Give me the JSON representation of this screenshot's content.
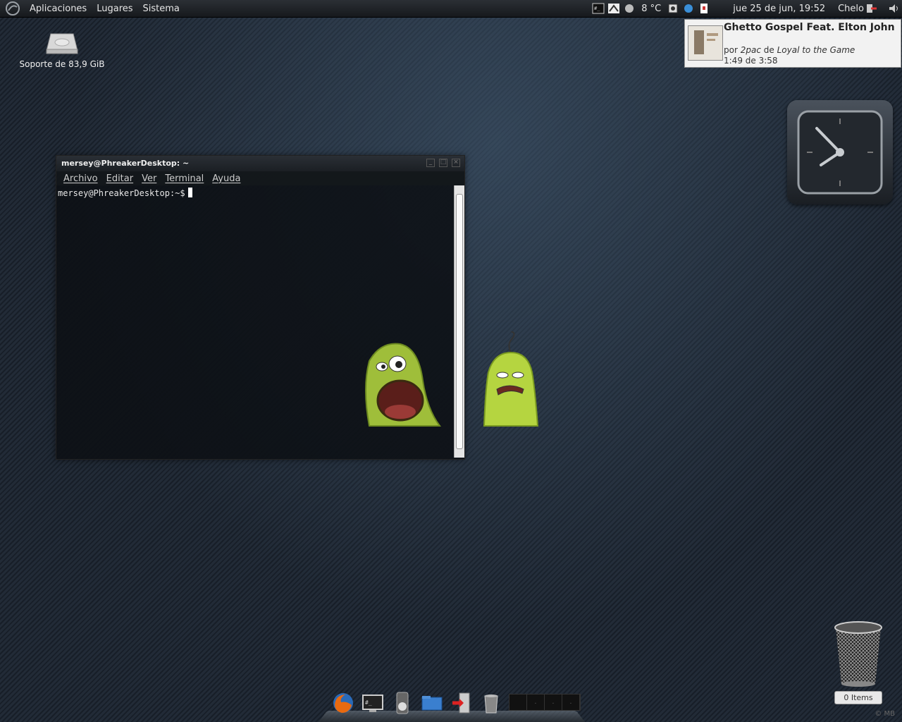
{
  "top_panel": {
    "menus": [
      "Aplicaciones",
      "Lugares",
      "Sistema"
    ],
    "temperature": "8 °C",
    "datetime": "jue 25 de jun, 19:52",
    "user": "Chelo"
  },
  "desktop": {
    "drive_label": "Soporte de 83,9 GiB",
    "trash_label": "0 Items",
    "credit": "© MB"
  },
  "notification": {
    "title": "Ghetto Gospel Feat. Elton John",
    "by_prefix": "por",
    "artist": "2pac",
    "album_prefix": "de",
    "album": "Loyal to the Game",
    "progress": "1:49 de 3:58"
  },
  "terminal": {
    "title": "mersey@PhreakerDesktop: ~",
    "menu": [
      "Archivo",
      "Editar",
      "Ver",
      "Terminal",
      "Ayuda"
    ],
    "prompt": "mersey@PhreakerDesktop:~$"
  },
  "dock": {
    "apps": [
      "firefox-icon",
      "terminal-icon",
      "media-player-icon",
      "file-manager-icon",
      "logout-icon",
      "trash-icon"
    ],
    "workspaces": [
      "",
      ".",
      ".",
      "."
    ]
  },
  "colors": {
    "background": "#1e2733",
    "panel": "#1d2126",
    "monster_green": "#a8c63c"
  }
}
